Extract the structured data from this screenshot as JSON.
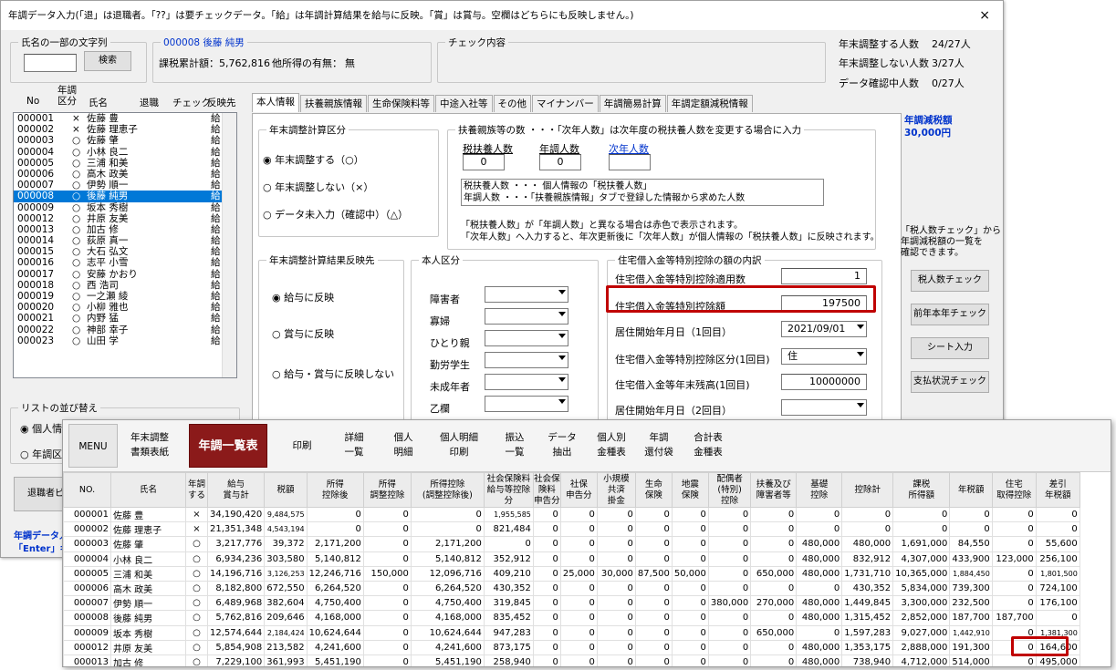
{
  "window": {
    "title": "年調データ入力(「退」は退職者。「??」は要チェックデータ。「給」は年調計算結果を給与に反映。「賞」は賞与。空欄はどちらにも反映しません。)",
    "close": "×"
  },
  "search": {
    "group": "氏名の一部の文字列",
    "button": "検索",
    "value": ""
  },
  "employee": {
    "header": "000008 後藤 純男",
    "taxable": "課税累計額：5,762,816",
    "other_income_label": "他所得の有無：",
    "other_income_value": "無"
  },
  "check": {
    "group": "チェック内容"
  },
  "stats": [
    {
      "label": "年末調整する人数",
      "value": "24/27人"
    },
    {
      "label": "年末調整しない人数",
      "value": "3/27人"
    },
    {
      "label": "データ確認中人数",
      "value": "0/27人"
    }
  ],
  "list_headers": {
    "no": "No",
    "kubun": "年調\n区分",
    "name": "氏名",
    "taishoku": "退職",
    "check": "チェック",
    "hanei": "反映先"
  },
  "employees": [
    {
      "no": "000001",
      "k": "×",
      "name": "佐藤 豊",
      "h": "給"
    },
    {
      "no": "000002",
      "k": "×",
      "name": "佐藤 理恵子",
      "h": "給"
    },
    {
      "no": "000003",
      "k": "○",
      "name": "佐藤 肇",
      "h": "給"
    },
    {
      "no": "000004",
      "k": "○",
      "name": "小林 良二",
      "h": "給"
    },
    {
      "no": "000005",
      "k": "○",
      "name": "三浦 和美",
      "h": "給"
    },
    {
      "no": "000006",
      "k": "○",
      "name": "高木 政美",
      "h": "給"
    },
    {
      "no": "000007",
      "k": "○",
      "name": "伊勢 順一",
      "h": "給"
    },
    {
      "no": "000008",
      "k": "○",
      "name": "後藤 純男",
      "h": "給"
    },
    {
      "no": "000009",
      "k": "○",
      "name": "坂本 秀樹",
      "h": "給"
    },
    {
      "no": "000012",
      "k": "○",
      "name": "井原 友美",
      "h": "給"
    },
    {
      "no": "000013",
      "k": "○",
      "name": "加古 修",
      "h": "給"
    },
    {
      "no": "000014",
      "k": "○",
      "name": "荻原 真一",
      "h": "給"
    },
    {
      "no": "000015",
      "k": "○",
      "name": "大石 弘文",
      "h": "給"
    },
    {
      "no": "000016",
      "k": "○",
      "name": "志平 小雪",
      "h": "給"
    },
    {
      "no": "000017",
      "k": "○",
      "name": "安藤 かおり",
      "h": "給"
    },
    {
      "no": "000018",
      "k": "○",
      "name": "西 浩司",
      "h": "給"
    },
    {
      "no": "000019",
      "k": "○",
      "name": "一之瀬 綾",
      "h": "給"
    },
    {
      "no": "000020",
      "k": "○",
      "name": "小柳 雅也",
      "h": "給"
    },
    {
      "no": "000021",
      "k": "○",
      "name": "内野 猛",
      "h": "給"
    },
    {
      "no": "000022",
      "k": "○",
      "name": "神部 幸子",
      "h": "給"
    },
    {
      "no": "000023",
      "k": "○",
      "name": "山田 学",
      "h": "給"
    }
  ],
  "sort": {
    "group": "リストの並び替え",
    "opt1": "個人情",
    "opt2": "年調区"
  },
  "retire_btn": "退職者ピ",
  "footer1": "年調データ入",
  "footer2": "「Enter」キ",
  "tabs": [
    "本人情報",
    "扶養親族情報",
    "生命保険料等",
    "中途入社等",
    "その他",
    "マイナンバー",
    "年調簡易計算",
    "年調定額減税情報"
  ],
  "calc": {
    "group": "年末調整計算区分",
    "opts": [
      "年末調整する（○）",
      "年末調整しない（×）",
      "データ未入力（確認中）（△）"
    ]
  },
  "dep": {
    "group": "扶養親族等の数 ・・・「次年人数」は次年度の税扶養人数を変更する場合に入力",
    "h1": "税扶養人数",
    "h2": "年調人数",
    "h3": "次年人数",
    "v1": "0",
    "v2": "0",
    "v3": "",
    "note1": "税扶養人数 ・・・ 個人情報の「税扶養人数」",
    "note2": "年調人数 ・・・「扶養親族情報」タブで登録した情報から求めた人数",
    "note3": "「税扶養人数」が「年調人数」と異なる場合は赤色で表示されます。",
    "note4": "「次年人数」へ入力すると、年次更新後に「次年人数」が個人情報の「税扶養人数」に反映されます。"
  },
  "reflect": {
    "group": "年末調整計算結果反映先",
    "opts": [
      "給与に反映",
      "賞与に反映",
      "給与・賞与に反映しない"
    ]
  },
  "self": {
    "group": "本人区分",
    "items": [
      "障害者",
      "寡婦",
      "ひとり親",
      "勤労学生",
      "未成年者",
      "乙欄"
    ]
  },
  "loan": {
    "group": "住宅借入金等特別控除の額の内訳",
    "r1l": "住宅借入金等特別控除適用数",
    "r1v": "1",
    "r2l": "住宅借入金等特別控除額",
    "r2v": "197500",
    "r3l": "居住開始年月日（1回目）",
    "r3v": "2021/09/01",
    "r4l": "住宅借入金等特別控除区分(1回目)",
    "r4v": "住",
    "r5l": "住宅借入金等年末残高(1回目)",
    "r5v": "10000000",
    "r6l": "居住開始年月日（2回目）",
    "r6v": ""
  },
  "side": {
    "title": "年調減税額",
    "amount": "30,000円",
    "note": "「税人数チェック」から\n年調減税額の一覧を\n確認できます。",
    "b1": "税人数チェック",
    "b2": "前年本年チェック",
    "b3": "シート入力",
    "b4": "支払状況チェック"
  },
  "toolbar": {
    "menu": "MENU",
    "b1": "年末調整\n書類表紙",
    "active": "年調一覧表",
    "b2": "印刷",
    "b3": "詳細\n一覧",
    "b4": "個人\n明細",
    "b5": "個人明細\n印刷",
    "b6": "振込\n一覧",
    "b7": "データ\n抽出",
    "b8": "個人別\n金種表",
    "b9": "年調\n還付袋",
    "b10": "合計表\n金種表"
  },
  "cols": [
    "NO.",
    "氏名",
    "年調\nする",
    "給与\n賞与計",
    "税額",
    "所得\n控除後",
    "所得\n調整控除",
    "所得控除\n(調整控除後)",
    "社会保険料\n給与等控除分",
    "社会保険料\n申告分",
    "社保\n申告分",
    "小規模\n共済\n掛金",
    "生命\n保険",
    "地震\n保険",
    "配偶者\n(特別)\n控除",
    "扶養及び\n障害者等",
    "基礎\n控除",
    "控除計",
    "課税\n所得額",
    "年税額",
    "住宅\n取得控除",
    "差引\n年税額"
  ],
  "rows": [
    [
      "000001",
      "佐藤 豊",
      "×",
      "34,190,420",
      "9,484,575",
      "0",
      "0",
      "0",
      "1,955,585",
      "0",
      "0",
      "0",
      "0",
      "0",
      "0",
      "0",
      "0",
      "0",
      "0",
      "0",
      "0",
      "0"
    ],
    [
      "000002",
      "佐藤 理恵子",
      "×",
      "21,351,348",
      "4,543,194",
      "0",
      "0",
      "0",
      "821,484",
      "0",
      "0",
      "0",
      "0",
      "0",
      "0",
      "0",
      "0",
      "0",
      "0",
      "0",
      "0",
      "0"
    ],
    [
      "000003",
      "佐藤 肇",
      "○",
      "3,217,776",
      "39,372",
      "2,171,200",
      "0",
      "2,171,200",
      "0",
      "0",
      "0",
      "0",
      "0",
      "0",
      "0",
      "0",
      "480,000",
      "480,000",
      "1,691,000",
      "84,550",
      "0",
      "55,600"
    ],
    [
      "000004",
      "小林 良二",
      "○",
      "6,934,236",
      "303,580",
      "5,140,812",
      "0",
      "5,140,812",
      "352,912",
      "0",
      "0",
      "0",
      "0",
      "0",
      "0",
      "0",
      "480,000",
      "832,912",
      "4,307,000",
      "433,900",
      "123,000",
      "256,100"
    ],
    [
      "000005",
      "三浦 和美",
      "○",
      "14,196,716",
      "3,126,253",
      "12,246,716",
      "150,000",
      "12,096,716",
      "409,210",
      "0",
      "25,000",
      "30,000",
      "87,500",
      "50,000",
      "0",
      "650,000",
      "480,000",
      "1,731,710",
      "10,365,000",
      "1,884,450",
      "0",
      "1,801,500"
    ],
    [
      "000006",
      "高木 政美",
      "○",
      "8,182,800",
      "672,550",
      "6,264,520",
      "0",
      "6,264,520",
      "430,352",
      "0",
      "0",
      "0",
      "0",
      "0",
      "0",
      "0",
      "0",
      "430,352",
      "5,834,000",
      "739,300",
      "0",
      "724,100"
    ],
    [
      "000007",
      "伊勢 順一",
      "○",
      "6,489,968",
      "382,604",
      "4,750,400",
      "0",
      "4,750,400",
      "319,845",
      "0",
      "0",
      "0",
      "0",
      "0",
      "380,000",
      "270,000",
      "480,000",
      "1,449,845",
      "3,300,000",
      "232,500",
      "0",
      "176,100"
    ],
    [
      "000008",
      "後藤 純男",
      "○",
      "5,762,816",
      "209,646",
      "4,168,000",
      "0",
      "4,168,000",
      "835,452",
      "0",
      "0",
      "0",
      "0",
      "0",
      "0",
      "0",
      "480,000",
      "1,315,452",
      "2,852,000",
      "187,700",
      "187,700",
      "0"
    ],
    [
      "000009",
      "坂本 秀樹",
      "○",
      "12,574,644",
      "2,184,424",
      "10,624,644",
      "0",
      "10,624,644",
      "947,283",
      "0",
      "0",
      "0",
      "0",
      "0",
      "0",
      "650,000",
      "0",
      "1,597,283",
      "9,027,000",
      "1,442,910",
      "0",
      "1,381,300"
    ],
    [
      "000012",
      "井原 友美",
      "○",
      "5,854,908",
      "213,582",
      "4,241,600",
      "0",
      "4,241,600",
      "873,175",
      "0",
      "0",
      "0",
      "0",
      "0",
      "0",
      "0",
      "480,000",
      "1,353,175",
      "2,888,000",
      "191,300",
      "0",
      "164,600"
    ],
    [
      "000013",
      "加古 修",
      "○",
      "7,229,100",
      "361,993",
      "5,451,190",
      "0",
      "5,451,190",
      "258,940",
      "0",
      "0",
      "0",
      "0",
      "0",
      "0",
      "0",
      "480,000",
      "738,940",
      "4,712,000",
      "514,000",
      "0",
      "495,000"
    ]
  ]
}
